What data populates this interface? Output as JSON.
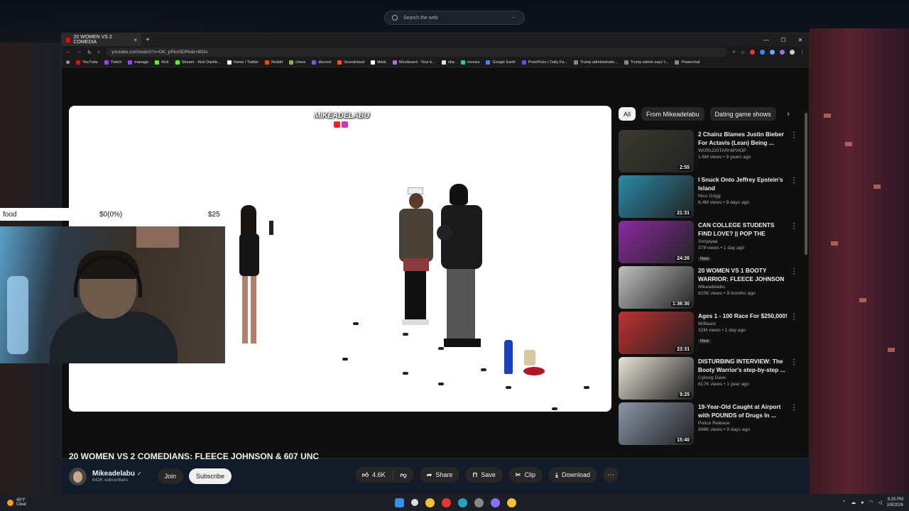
{
  "desktop": {
    "search_placeholder": "Search the web",
    "search_dots": "⋯"
  },
  "browser": {
    "tab_title": "20 WOMEN VS 2 COMEDIA",
    "tab_close": "×",
    "new_tab": "+",
    "win_minimize": "—",
    "win_maximize": "☐",
    "win_close": "✕",
    "url": "youtube.com/watch?v=OK_pPkvNDRk&t=893s",
    "bookmarks": [
      {
        "label": "YouTube",
        "color": "#ff0000"
      },
      {
        "label": "Twitch",
        "color": "#9146ff"
      },
      {
        "label": "manage",
        "color": "#9146ff"
      },
      {
        "label": "Kick",
        "color": "#53fc18"
      },
      {
        "label": "Stream - Kick Dashb...",
        "color": "#53fc18"
      },
      {
        "label": "Home / Twitter",
        "color": "#ffffff"
      },
      {
        "label": "Reddit",
        "color": "#ff4500"
      },
      {
        "label": "chess",
        "color": "#81b64c"
      },
      {
        "label": "discord",
        "color": "#5865f2"
      },
      {
        "label": "Soundcloud",
        "color": "#ff5500"
      },
      {
        "label": "tiktok",
        "color": "#ffffff"
      },
      {
        "label": "Moviboard - Your b...",
        "color": "#b06ee0"
      },
      {
        "label": "nba",
        "color": "#e0e0e0"
      },
      {
        "label": "movies",
        "color": "#1ec8c8"
      },
      {
        "label": "Google Earth",
        "color": "#4285f4"
      },
      {
        "label": "PrizePicks | Daily Fa...",
        "color": "#7a3cff"
      },
      {
        "label": "Trump administratio...",
        "color": "#888888"
      },
      {
        "label": "Trump admin says 't...",
        "color": "#888888"
      },
      {
        "label": "Powerchat",
        "color": "#888888"
      }
    ]
  },
  "video": {
    "watermark": "MIKEADELABU",
    "title": "20 WOMEN VS 2 COMEDIANS: FLEECE JOHNSON & 607 UNC",
    "channel": "Mikeadelabu",
    "subscribers": "642K subscribers",
    "join_label": "Join",
    "subscribe_label": "Subscribe",
    "likes": "4.6K",
    "share_label": "Share",
    "save_label": "Save",
    "clip_label": "Clip",
    "download_label": "Download",
    "more_label": "⋯"
  },
  "overlay": {
    "goal_name": "food",
    "goal_progress": "$0(0%)",
    "goal_target": "$25"
  },
  "sidebar": {
    "chips": [
      {
        "label": "All",
        "active": true
      },
      {
        "label": "From Mikeadelabu",
        "active": false
      },
      {
        "label": "Dating game shows",
        "active": false
      }
    ],
    "chip_next": "›",
    "videos": [
      {
        "title": "2 Chainz Blames Justin Bieber For Actavis (Lean) Being ...",
        "channel": "WORLDSTARHIPHOP",
        "meta": "1.5M views • 9 years ago",
        "duration": "2:55",
        "badge": "",
        "thumb_color": "#3a3a30"
      },
      {
        "title": "I Snuck Onto Jeffrey Epstein's Island",
        "channel": "Nico Grigg",
        "meta": "6.4M views • 9 days ago",
        "duration": "21:31",
        "badge": "",
        "thumb_color": "#2a8aa8"
      },
      {
        "title": "CAN COLLEGE STUDENTS FIND LOVE? || POP THE BALLON LS...",
        "channel": "Sxnjayaa",
        "meta": "378 views • 1 day ago",
        "duration": "24:26",
        "badge": "New",
        "thumb_color": "#8a2aa0"
      },
      {
        "title": "20 WOMEN VS 1 BOOTY WARRIOR: FLEECE JOHNSON",
        "channel": "Mikeadelabu",
        "meta": "810K views • 9 months ago",
        "duration": "1:36:30",
        "badge": "",
        "thumb_color": "#c0c0c0"
      },
      {
        "title": "Ages 1 - 100 Race For $250,000!",
        "channel": "MrBeast",
        "meta": "32M views • 1 day ago",
        "duration": "23:31",
        "badge": "New",
        "thumb_color": "#c03030"
      },
      {
        "title": "DISTURBING INTERVIEW: The Booty Warrior's step-by-step ...",
        "channel": "Cyborg Dave",
        "meta": "617K views • 1 year ago",
        "duration": "9:25",
        "badge": "",
        "thumb_color": "#e8e4d8"
      },
      {
        "title": "19-Year-Old Caught at Airport with POUNDS of Drugs In ...",
        "channel": "Police Release",
        "meta": "946K views • 9 days ago",
        "duration": "15:40",
        "badge": "",
        "thumb_color": "#8a96a8"
      }
    ]
  },
  "taskbar": {
    "temp": "45°F",
    "weather": "Clear",
    "time": "9:25 PM",
    "date": "2/8/2026"
  }
}
